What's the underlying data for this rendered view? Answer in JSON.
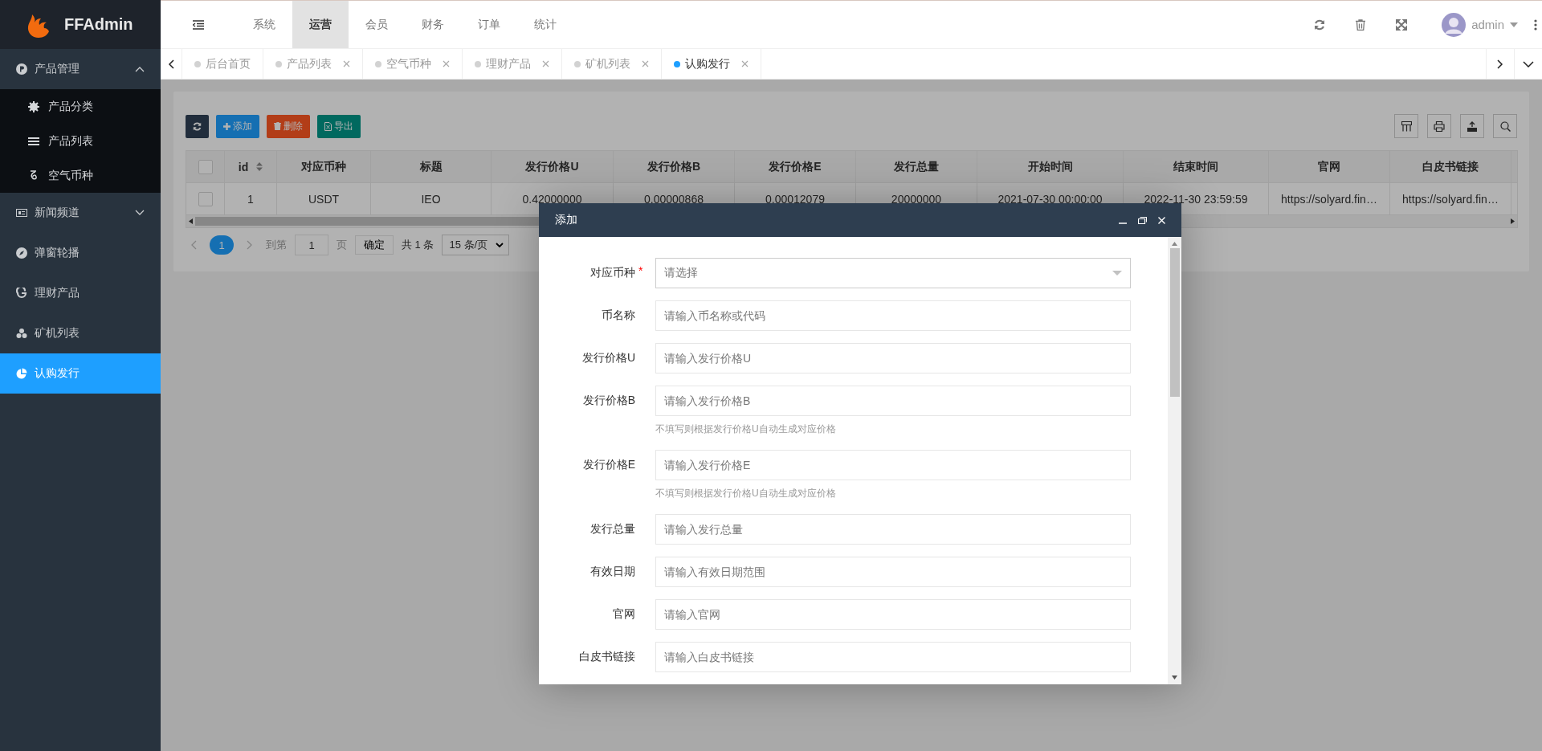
{
  "app": {
    "logo": "FFAdmin"
  },
  "top_nav": [
    {
      "label": "系统",
      "selected": false
    },
    {
      "label": "运营",
      "selected": true
    },
    {
      "label": "会员",
      "selected": false
    },
    {
      "label": "财务",
      "selected": false
    },
    {
      "label": "订单",
      "selected": false
    },
    {
      "label": "统计",
      "selected": false
    }
  ],
  "user": {
    "name": "admin"
  },
  "sidebar": {
    "items": [
      {
        "label": "产品管理",
        "selected": false,
        "expanded": true,
        "children": [
          {
            "label": "产品分类",
            "selected": false
          },
          {
            "label": "产品列表",
            "selected": false
          },
          {
            "label": "空气币种",
            "selected": false
          }
        ]
      },
      {
        "label": "新闻频道",
        "selected": false,
        "expanded": false
      },
      {
        "label": "弹窗轮播",
        "selected": false
      },
      {
        "label": "理财产品",
        "selected": false
      },
      {
        "label": "矿机列表",
        "selected": false
      },
      {
        "label": "认购发行",
        "selected": true
      }
    ]
  },
  "tabs": [
    {
      "label": "后台首页",
      "selected": false,
      "closable": false
    },
    {
      "label": "产品列表",
      "selected": false,
      "closable": true
    },
    {
      "label": "空气币种",
      "selected": false,
      "closable": true
    },
    {
      "label": "理财产品",
      "selected": false,
      "closable": true
    },
    {
      "label": "矿机列表",
      "selected": false,
      "closable": true
    },
    {
      "label": "认购发行",
      "selected": true,
      "closable": true
    }
  ],
  "toolbar": [
    {
      "label": "添加",
      "kind": "add"
    },
    {
      "label": "删除",
      "kind": "delete"
    },
    {
      "label": "导出",
      "kind": "export"
    }
  ],
  "table": {
    "all_checked": false,
    "columns": [
      "id",
      "对应币种",
      "标题",
      "发行价格U",
      "发行价格B",
      "发行价格E",
      "发行总量",
      "开始时间",
      "结束时间",
      "官网",
      "白皮书链接"
    ],
    "rows": [
      {
        "checked": false,
        "cells": [
          "1",
          "USDT",
          "IEO",
          "0.42000000",
          "0.00000868",
          "0.00012079",
          "20000000",
          "2021-07-30 00:00:00",
          "2022-11-30 23:59:59",
          "https://solyard.fin…",
          "https://solyard.fin…"
        ]
      }
    ]
  },
  "pagination": {
    "current": "1",
    "goto": "到第",
    "page_input": "1",
    "page_unit": "页",
    "confirm": "确定",
    "total": "共 1 条",
    "page_size": "15 条/页"
  },
  "modal": {
    "title": "添加",
    "required_mark": "*",
    "fields": [
      {
        "label": "对应币种",
        "required": true,
        "kind": "select",
        "placeholder": "请选择"
      },
      {
        "label": "币名称",
        "required": false,
        "kind": "text",
        "placeholder": "请输入币名称或代码"
      },
      {
        "label": "发行价格U",
        "required": false,
        "kind": "text",
        "placeholder": "请输入发行价格U"
      },
      {
        "label": "发行价格B",
        "required": false,
        "kind": "text",
        "placeholder": "请输入发行价格B",
        "hint": "不填写则根据发行价格U自动生成对应价格"
      },
      {
        "label": "发行价格E",
        "required": false,
        "kind": "text",
        "placeholder": "请输入发行价格E",
        "hint": "不填写则根据发行价格U自动生成对应价格"
      },
      {
        "label": "发行总量",
        "required": false,
        "kind": "text",
        "placeholder": "请输入发行总量"
      },
      {
        "label": "有效日期",
        "required": false,
        "kind": "text",
        "placeholder": "请输入有效日期范围"
      },
      {
        "label": "官网",
        "required": false,
        "kind": "text",
        "placeholder": "请输入官网"
      },
      {
        "label": "白皮书链接",
        "required": false,
        "kind": "text",
        "placeholder": "请输入白皮书链接"
      }
    ]
  }
}
